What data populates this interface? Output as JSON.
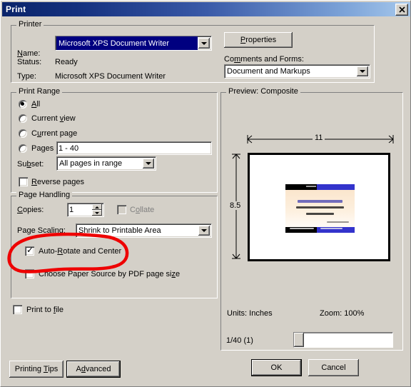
{
  "window": {
    "title": "Print",
    "close_icon": "close-icon",
    "close_glyph": "✕"
  },
  "printer": {
    "group_label": "Printer",
    "name_label": "Name:",
    "name_value": "Microsoft XPS Document Writer",
    "properties_button": "Properties",
    "status_label": "Status:",
    "status_value": "Ready",
    "type_label": "Type:",
    "type_value": "Microsoft XPS Document Writer",
    "comments_label": "Comments and Forms:",
    "comments_value": "Document and Markups"
  },
  "print_range": {
    "group_label": "Print Range",
    "options": [
      {
        "label": "All",
        "selected": true
      },
      {
        "label": "Current view",
        "selected": false
      },
      {
        "label": "Current page",
        "selected": false
      },
      {
        "label": "Pages",
        "selected": false
      }
    ],
    "pages_value": "1 - 40",
    "subset_label": "Subset:",
    "subset_value": "All pages in range",
    "reverse_label": "Reverse pages",
    "reverse_checked": false
  },
  "page_handling": {
    "group_label": "Page Handling",
    "copies_label": "Copies:",
    "copies_value": "1",
    "collate_label": "Collate",
    "collate_checked": false,
    "collate_disabled": true,
    "scaling_label": "Page Scaling:",
    "scaling_value": "Shrink to Printable Area",
    "auto_rotate_label": "Auto-Rotate and Center",
    "auto_rotate_checked": true,
    "paper_source_label": "Choose Paper Source by PDF page size",
    "paper_source_checked": false
  },
  "print_to_file": {
    "label": "Print to file",
    "checked": false
  },
  "preview": {
    "group_label": "Preview: Composite",
    "width_dim": "11",
    "height_dim": "8.5",
    "units_text": "Units: Inches",
    "zoom_text": "Zoom: 100%",
    "page_counter": "1/40 (1)"
  },
  "footer": {
    "printing_tips": "Printing Tips",
    "advanced": "Advanced",
    "ok": "OK",
    "cancel": "Cancel"
  },
  "annotation": {
    "type": "hand-drawn-red-ellipse",
    "color": "#ee0000"
  },
  "colors": {
    "dialog_bg": "#d4d0c8",
    "titlebar_start": "#0a246a",
    "titlebar_end": "#a6c8ec",
    "selection": "#000080",
    "annotation_red": "#ee0000"
  }
}
